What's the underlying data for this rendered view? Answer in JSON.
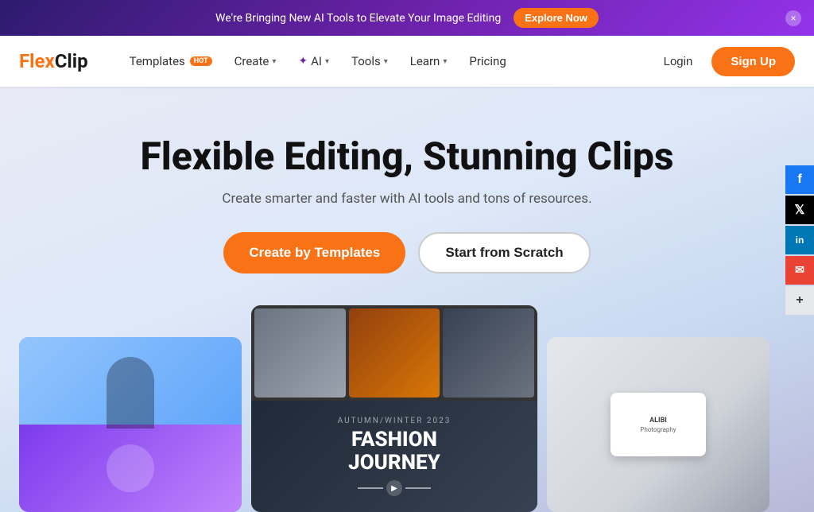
{
  "banner": {
    "text": "We're Bringing New AI Tools to Elevate Your Image Editing",
    "explore_label": "Explore Now",
    "close_label": "×"
  },
  "navbar": {
    "logo_flex": "Flex",
    "logo_clip": "Clip",
    "nav_items": [
      {
        "id": "templates",
        "label": "Templates",
        "badge": "HOT",
        "has_dropdown": false
      },
      {
        "id": "create",
        "label": "Create",
        "has_dropdown": true
      },
      {
        "id": "ai",
        "label": "AI",
        "has_dropdown": true,
        "has_star": true
      },
      {
        "id": "tools",
        "label": "Tools",
        "has_dropdown": true
      },
      {
        "id": "learn",
        "label": "Learn",
        "has_dropdown": true
      },
      {
        "id": "pricing",
        "label": "Pricing",
        "has_dropdown": false
      }
    ],
    "login_label": "Login",
    "signup_label": "Sign Up"
  },
  "hero": {
    "title": "Flexible Editing, Stunning Clips",
    "subtitle": "Create smarter and faster with AI tools and tons of resources.",
    "btn_templates": "Create by Templates",
    "btn_scratch": "Start from Scratch"
  },
  "preview": {
    "fashion_label": "FASHION JOURNEY",
    "fashion_sublabel": "AUTUMN/WINTER 2023"
  },
  "social": {
    "items": [
      {
        "id": "facebook",
        "icon": "f",
        "label": "facebook-icon"
      },
      {
        "id": "twitter",
        "icon": "𝕏",
        "label": "twitter-icon"
      },
      {
        "id": "linkedin",
        "icon": "in",
        "label": "linkedin-icon"
      },
      {
        "id": "email",
        "icon": "✉",
        "label": "email-icon"
      },
      {
        "id": "more",
        "icon": "+",
        "label": "more-icon"
      }
    ]
  }
}
